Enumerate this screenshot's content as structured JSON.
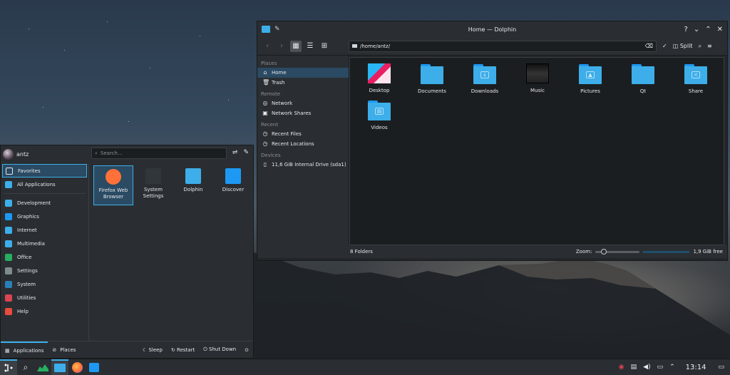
{
  "dolphin": {
    "title": "Home — Dolphin",
    "location": "/home/antz/",
    "split_label": "Split",
    "places": [
      {
        "type": "section",
        "label": "Places"
      },
      {
        "type": "item",
        "label": "Home",
        "icon": "home-icon",
        "glyph": "⌂",
        "selected": true
      },
      {
        "type": "item",
        "label": "Trash",
        "icon": "trash-icon",
        "glyph": "🗑"
      },
      {
        "type": "section",
        "label": "Remote"
      },
      {
        "type": "item",
        "label": "Network",
        "icon": "network-icon",
        "glyph": "◎"
      },
      {
        "type": "item",
        "label": "Network Shares",
        "icon": "network-shares-icon",
        "glyph": "▣"
      },
      {
        "type": "section",
        "label": "Recent"
      },
      {
        "type": "item",
        "label": "Recent Files",
        "icon": "recent-files-icon",
        "glyph": "◷"
      },
      {
        "type": "item",
        "label": "Recent Locations",
        "icon": "recent-locations-icon",
        "glyph": "◷"
      },
      {
        "type": "section",
        "label": "Devices"
      },
      {
        "type": "item",
        "label": "11,6 GiB Internal Drive (sda1)",
        "icon": "drive-icon",
        "glyph": "▯"
      }
    ],
    "files": [
      {
        "name": "Desktop",
        "kind": "desktop",
        "emblem": ""
      },
      {
        "name": "Documents",
        "kind": "folder",
        "emblem": ""
      },
      {
        "name": "Downloads",
        "kind": "folder",
        "emblem": "↓"
      },
      {
        "name": "Music",
        "kind": "music",
        "emblem": ""
      },
      {
        "name": "Pictures",
        "kind": "folder",
        "emblem": "▲"
      },
      {
        "name": "Qt",
        "kind": "folder",
        "emblem": ""
      },
      {
        "name": "Share",
        "kind": "folder",
        "emblem": "<"
      },
      {
        "name": "Videos",
        "kind": "folder",
        "emblem": "▤"
      }
    ],
    "status": {
      "count": "8 Folders",
      "zoom_label": "Zoom:",
      "free": "1,9 GiB free"
    }
  },
  "kickoff": {
    "user": "antz",
    "search_placeholder": "Search...",
    "categories": [
      {
        "label": "Favorites",
        "selected": true,
        "color": "#2b4a63"
      },
      {
        "label": "All Applications",
        "color": "#3daee9"
      },
      {
        "sep": true
      },
      {
        "label": "Development",
        "color": "#3daee9"
      },
      {
        "label": "Graphics",
        "color": "#1d99f3"
      },
      {
        "label": "Internet",
        "color": "#3daee9"
      },
      {
        "label": "Multimedia",
        "color": "#3daee9"
      },
      {
        "label": "Office",
        "color": "#27ae60"
      },
      {
        "label": "Settings",
        "color": "#7f8c8d"
      },
      {
        "label": "System",
        "color": "#2980b9"
      },
      {
        "label": "Utilities",
        "color": "#da4453"
      },
      {
        "label": "Help",
        "color": "#e74c3c"
      }
    ],
    "apps": [
      {
        "name": "Firefox Web Browser",
        "line1": "Firefox Web",
        "line2": "Browser",
        "selected": true,
        "color": "#ff7139"
      },
      {
        "name": "System Settings",
        "line1": "System",
        "line2": "Settings",
        "color": "#31363b"
      },
      {
        "name": "Dolphin",
        "line1": "Dolphin",
        "line2": "",
        "color": "#3daee9"
      },
      {
        "name": "Discover",
        "line1": "Discover",
        "line2": "",
        "color": "#1d99f3"
      }
    ],
    "footer": {
      "applications": "Applications",
      "places": "Places",
      "sleep": "Sleep",
      "restart": "Restart",
      "shutdown": "Shut Down"
    }
  },
  "taskbar": {
    "clock": "13:14"
  }
}
